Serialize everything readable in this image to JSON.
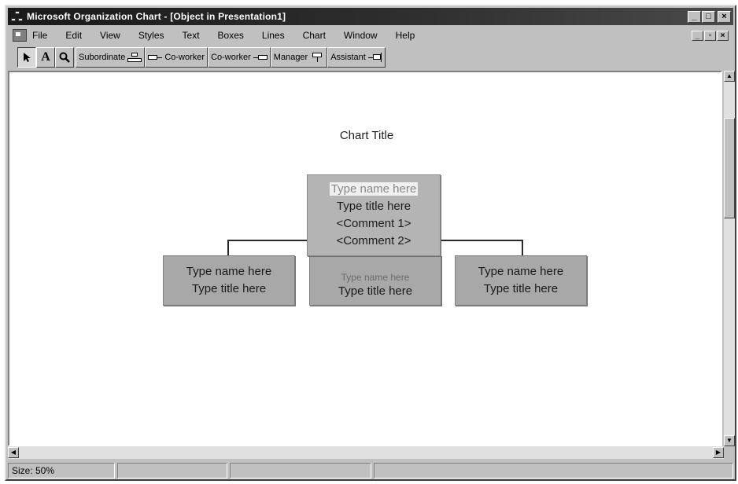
{
  "window": {
    "title": "Microsoft Organization Chart - [Object in Presentation1]",
    "controls": {
      "minimize": "_",
      "maximize": "□",
      "close": "×"
    },
    "mdi_controls": {
      "minimize": "_",
      "restore": "▫",
      "close": "×"
    }
  },
  "menu": {
    "items": [
      {
        "label": "File"
      },
      {
        "label": "Edit"
      },
      {
        "label": "View"
      },
      {
        "label": "Styles"
      },
      {
        "label": "Text"
      },
      {
        "label": "Boxes"
      },
      {
        "label": "Lines"
      },
      {
        "label": "Chart"
      },
      {
        "label": "Window"
      },
      {
        "label": "Help"
      }
    ]
  },
  "toolbar": {
    "select_icon": "arrow-pointer",
    "text_tool": "A",
    "zoom_icon": "magnifier",
    "subordinate": "Subordinate",
    "coworker_left": "Co-worker",
    "coworker_right": "Co-worker",
    "manager": "Manager",
    "assistant": "Assistant"
  },
  "chart": {
    "title": "Chart Title",
    "manager": {
      "name": "Type name here",
      "title": "Type title here",
      "comment1": "<Comment 1>",
      "comment2": "<Comment 2>"
    },
    "subordinates": [
      {
        "name": "Type name here",
        "title": "Type title here"
      },
      {
        "name": "Type name here",
        "title": "Type title here"
      },
      {
        "name": "Type name here",
        "title": "Type title here"
      }
    ]
  },
  "status": {
    "size": "Size: 50%"
  }
}
